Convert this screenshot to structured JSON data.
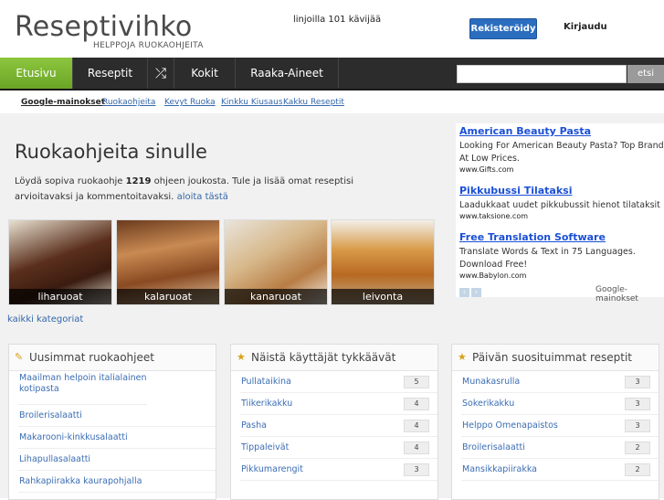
{
  "header": {
    "logo_name": "Reseptivihko",
    "logo_tagline": "HELPPOJA RUOKAOHJEITA",
    "online_text": "linjoilla 101 kävijää",
    "register_label": "Rekisteröidy",
    "login_label": "Kirjaudu"
  },
  "nav": {
    "items": [
      "Etusivu",
      "Reseptit",
      "⤮",
      "Kokit",
      "Raaka-Aineet"
    ],
    "search_button": "etsi",
    "search_placeholder": ""
  },
  "linksbar": {
    "google_label": "Google-mainokset",
    "links": [
      "Ruokaohjeita",
      "Kevyt Ruoka",
      "Kinkku Kiusaus",
      "Kakku Reseptit"
    ]
  },
  "intro": {
    "title": "Ruokaohjeita sinulle",
    "text_before": "Löydä sopiva ruokaohje ",
    "count": "1219",
    "text_after": " ohjeen joukosta. Tule ja lisää omat reseptisi arvioitavaksi ja kommentoitavaksi.",
    "link": "aloita tästä"
  },
  "categories": {
    "tiles": [
      "liharuoat",
      "kalaruoat",
      "kanaruoat",
      "leivonta"
    ],
    "all_link": "kaikki kategoriat"
  },
  "ads": {
    "items": [
      {
        "title": "American Beauty Pasta",
        "desc": "Looking For American Beauty Pasta? Top Brand At Low Prices.",
        "url": "www.Gifts.com"
      },
      {
        "title": "Pikkubussi Tilataksi",
        "desc": "Laadukkaat uudet pikkubussit hienot tilataksit",
        "url": "www.taksione.com"
      },
      {
        "title": "Free Translation Software",
        "desc": "Translate Words & Text in 75 Languages. Download Free!",
        "url": "www.Babylon.com"
      }
    ],
    "prev": "‹",
    "next": "›",
    "google_mark": "Google-mainokset"
  },
  "panels": {
    "latest": {
      "title": "Uusimmat ruokaohjeet",
      "icon": "notepad-icon",
      "items": [
        "Maailman helpoin italialainen kotipasta",
        "Broilerisalaatti",
        "Makarooni-kinkkusalaatti",
        "Lihapullasalaatti",
        "Rahkapiirakka kaurapohjalla"
      ]
    },
    "liked": {
      "title": "Näistä käyttäjät tykkäävät",
      "icon": "star-icon",
      "items": [
        {
          "name": "Pullataikina",
          "count": "5"
        },
        {
          "name": "Tiikerikakku",
          "count": "4"
        },
        {
          "name": "Pasha",
          "count": "4"
        },
        {
          "name": "Tippaleivät",
          "count": "4"
        },
        {
          "name": "Pikkumarengit",
          "count": "3"
        }
      ]
    },
    "popular": {
      "title": "Päivän suosituimmat reseptit",
      "icon": "star-icon",
      "items": [
        {
          "name": "Munakasrulla",
          "count": "3"
        },
        {
          "name": "Sokerikakku",
          "count": "3"
        },
        {
          "name": "Helppo Omenapaistos",
          "count": "3"
        },
        {
          "name": "Broilerisalaatti",
          "count": "2"
        },
        {
          "name": "Mansikkapiirakka",
          "count": "2"
        }
      ]
    }
  }
}
